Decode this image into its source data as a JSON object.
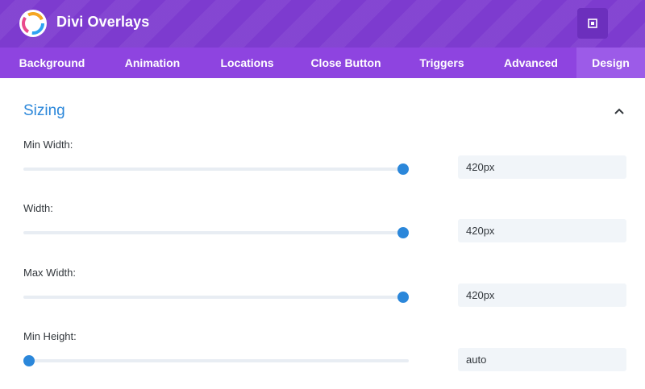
{
  "header": {
    "title": "Divi Overlays",
    "logo_icon": "divi-overlays-logo-icon",
    "expand_icon": "expand-icon"
  },
  "tabs": [
    {
      "label": "Background",
      "active": false
    },
    {
      "label": "Animation",
      "active": false
    },
    {
      "label": "Locations",
      "active": false
    },
    {
      "label": "Close Button",
      "active": false
    },
    {
      "label": "Triggers",
      "active": false
    },
    {
      "label": "Advanced",
      "active": false
    },
    {
      "label": "Design",
      "active": true
    }
  ],
  "section": {
    "title": "Sizing",
    "toggle_icon": "chevron-up-icon",
    "fields": [
      {
        "label": "Min Width:",
        "value": "420px",
        "slider_level": 1.0
      },
      {
        "label": "Width:",
        "value": "420px",
        "slider_level": 1.0
      },
      {
        "label": "Max Width:",
        "value": "420px",
        "slider_level": 1.0
      },
      {
        "label": "Min Height:",
        "value": "auto",
        "slider_level": 0.0
      }
    ]
  },
  "colors": {
    "header_bg": "#7d3bcf",
    "tabs_bg": "#8e44e0",
    "active_tab_bg": "#9c5be8",
    "accent": "#2b87da",
    "slider_track": "#e8edf3",
    "input_bg": "#f1f5f9"
  }
}
